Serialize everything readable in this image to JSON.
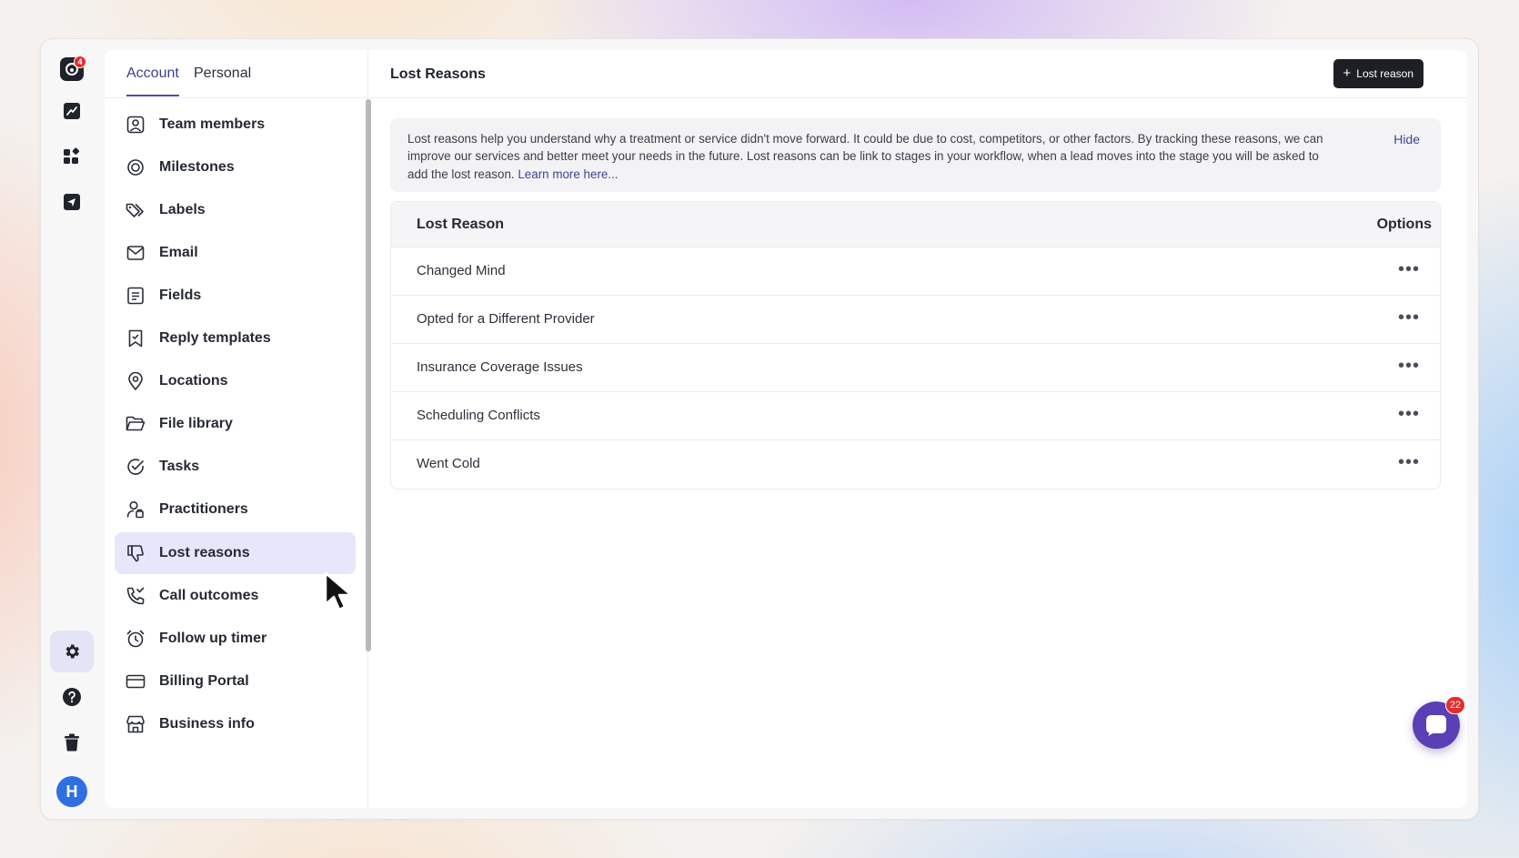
{
  "rail": {
    "logo_badge": "4",
    "avatar_initial": "H",
    "items": [
      {
        "icon": "analytics-icon"
      },
      {
        "icon": "apps-grid-icon"
      },
      {
        "icon": "send-icon"
      },
      {
        "icon": "gear-icon"
      },
      {
        "icon": "help-icon"
      },
      {
        "icon": "trash-icon"
      }
    ]
  },
  "tabs": [
    {
      "label": "Account",
      "active": true
    },
    {
      "label": "Personal",
      "active": false
    }
  ],
  "nav": [
    {
      "label": "Team members",
      "icon": "user-square-icon"
    },
    {
      "label": "Milestones",
      "icon": "target-icon"
    },
    {
      "label": "Labels",
      "icon": "tags-icon"
    },
    {
      "label": "Email",
      "icon": "mail-icon"
    },
    {
      "label": "Fields",
      "icon": "fields-icon"
    },
    {
      "label": "Reply templates",
      "icon": "bookmark-icon"
    },
    {
      "label": "Locations",
      "icon": "location-pin-icon"
    },
    {
      "label": "File library",
      "icon": "folder-open-icon"
    },
    {
      "label": "Tasks",
      "icon": "check-circle-icon"
    },
    {
      "label": "Practitioners",
      "icon": "practitioner-icon"
    },
    {
      "label": "Lost reasons",
      "icon": "thumbs-down-icon",
      "active": true
    },
    {
      "label": "Call outcomes",
      "icon": "phone-outgoing-icon"
    },
    {
      "label": "Follow up timer",
      "icon": "alarm-clock-icon"
    },
    {
      "label": "Billing Portal",
      "icon": "credit-card-icon"
    },
    {
      "label": "Business info",
      "icon": "store-icon"
    }
  ],
  "main": {
    "title": "Lost Reasons",
    "add_button_label": "Lost reason",
    "info_text": "Lost reasons help you understand why a treatment or service didn't move forward. It could be due to cost, competitors, or other factors. By tracking these reasons, we can improve our services and better meet your needs in the future. Lost reasons can be link to stages in your workflow, when a lead moves into the stage you will be asked to add the lost reason.",
    "info_link": "Learn more here...",
    "hide_label": "Hide",
    "table": {
      "headers": [
        "Lost Reason",
        "Options"
      ],
      "rows": [
        "Changed Mind",
        "Opted for a Different Provider",
        "Insurance Coverage Issues",
        "Scheduling Conflicts",
        "Went Cold"
      ],
      "row_options": "•••"
    }
  },
  "chat": {
    "badge": "22"
  },
  "colors": {
    "accent": "#4b50a8",
    "active_bg": "#e6e7fa",
    "primary_button": "#1d1f24",
    "chat": "#5b3fb4",
    "badge": "#e62b2b"
  }
}
